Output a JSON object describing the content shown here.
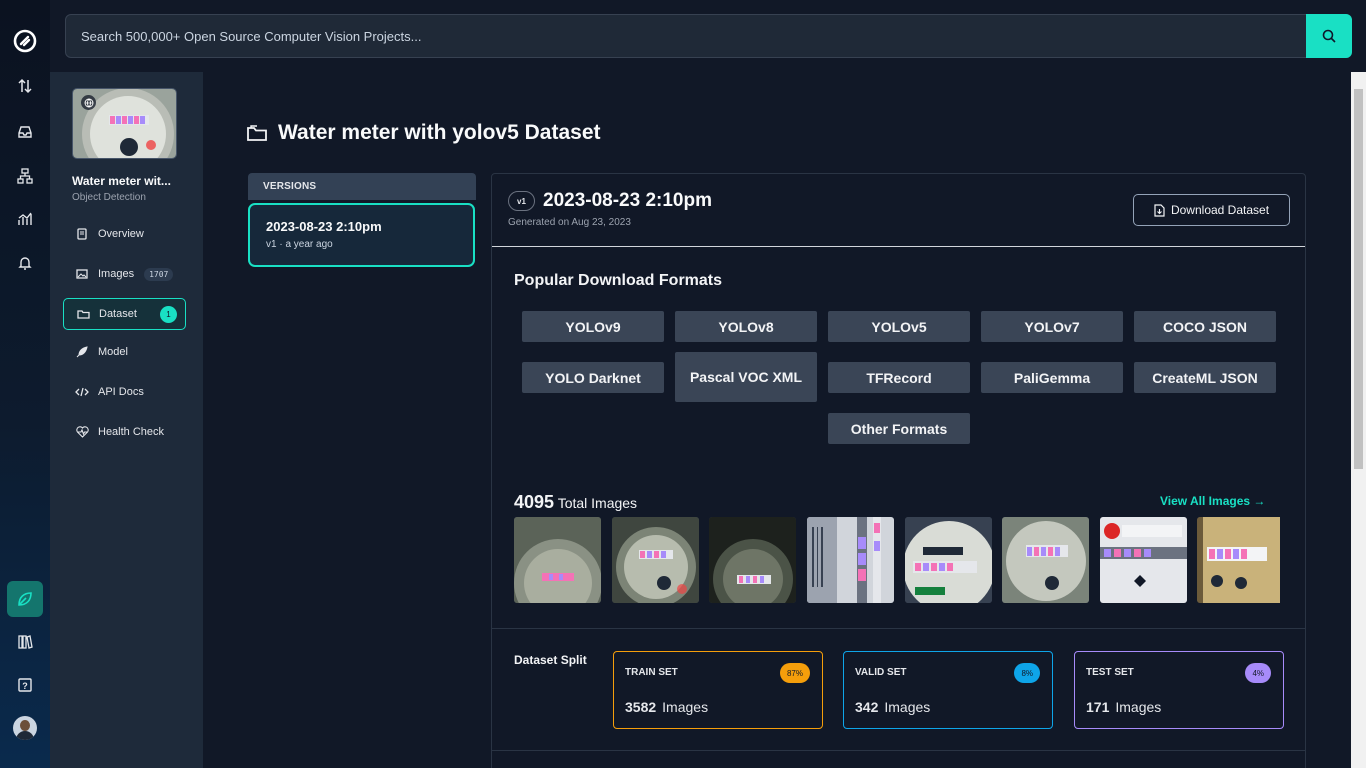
{
  "search": {
    "placeholder": "Search 500,000+ Open Source Computer Vision Projects..."
  },
  "project": {
    "name": "Water meter wit...",
    "type": "Object Detection"
  },
  "nav": [
    {
      "label": "Overview",
      "icon": "book-icon"
    },
    {
      "label": "Images",
      "icon": "image-icon",
      "count": "1707"
    },
    {
      "label": "Dataset",
      "icon": "folder-icon",
      "count": "1"
    },
    {
      "label": "Model",
      "icon": "rocket-icon"
    },
    {
      "label": "API Docs",
      "icon": "code-icon"
    },
    {
      "label": "Health Check",
      "icon": "heart-pulse-icon"
    }
  ],
  "page": {
    "title": "Water meter with yolov5 Dataset"
  },
  "versions": {
    "header": "VERSIONS",
    "items": [
      {
        "title": "2023-08-23 2:10pm",
        "subtitle": "v1 · a year ago"
      }
    ]
  },
  "version_detail": {
    "badge": "v1",
    "title": "2023-08-23 2:10pm",
    "generated": "Generated on Aug 23, 2023",
    "download_label": "Download Dataset"
  },
  "formats": {
    "title": "Popular Download Formats",
    "items": [
      "YOLOv9",
      "YOLOv8",
      "YOLOv5",
      "YOLOv7",
      "COCO JSON",
      "YOLO Darknet",
      "Pascal VOC XML",
      "TFRecord",
      "PaliGemma",
      "CreateML JSON",
      "Other Formats"
    ]
  },
  "images": {
    "total": "4095",
    "total_label": "Total Images",
    "view_all": "View All Images →"
  },
  "split": {
    "title": "Dataset Split",
    "sets": [
      {
        "name": "TRAIN SET",
        "pct": "87%",
        "count": "3582",
        "unit": "Images",
        "color": "#f59e0b"
      },
      {
        "name": "VALID SET",
        "pct": "8%",
        "count": "342",
        "unit": "Images",
        "color": "#0ea5e9"
      },
      {
        "name": "TEST SET",
        "pct": "4%",
        "count": "171",
        "unit": "Images",
        "color": "#a78bfa"
      }
    ]
  },
  "colors": {
    "accent": "#19e0c4",
    "background": "#111827",
    "sidebar": "#1e2a3a"
  }
}
